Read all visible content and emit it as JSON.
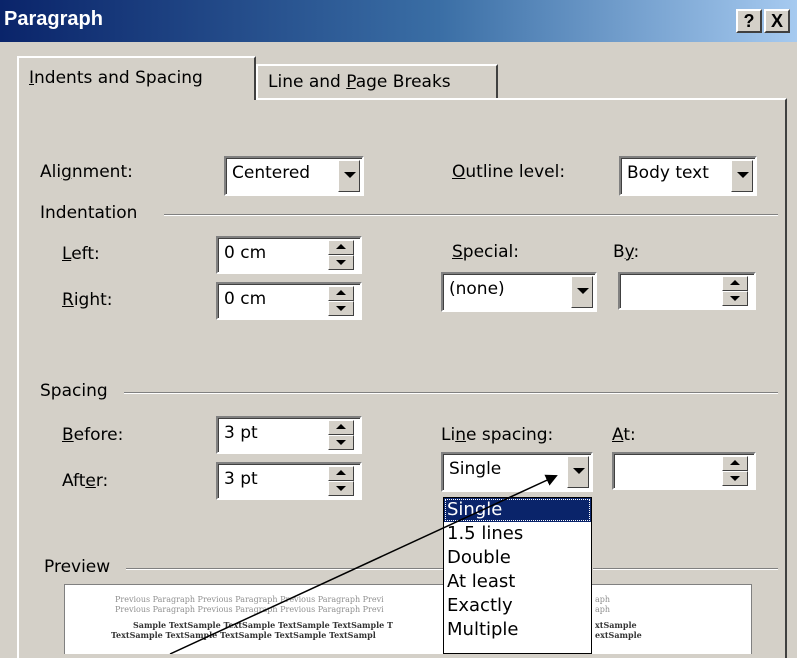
{
  "window": {
    "title": "Paragraph",
    "help_label": "?",
    "close_label": "X"
  },
  "tabs": [
    {
      "label_pre": "",
      "label_key": "I",
      "label_post": "ndents and Spacing",
      "active": true
    },
    {
      "label_pre": "Line and ",
      "label_key": "P",
      "label_post": "age Breaks",
      "active": false
    }
  ],
  "general": {
    "alignment": {
      "pre": "Ali",
      "key": "g",
      "post": "nment:",
      "value": "Centered"
    },
    "outline": {
      "pre": "",
      "key": "O",
      "post": "utline level:",
      "value": "Body text"
    }
  },
  "indentation": {
    "group_label": "Indentation",
    "left": {
      "pre": "",
      "key": "L",
      "post": "eft:",
      "value": "0 cm"
    },
    "right": {
      "pre": "",
      "key": "R",
      "post": "ight:",
      "value": "0 cm"
    },
    "special": {
      "pre": "",
      "key": "S",
      "post": "pecial:",
      "value": "(none)"
    },
    "by": {
      "pre": "B",
      "key": "y",
      "post": ":",
      "value": ""
    }
  },
  "spacing": {
    "group_label": "Spacing",
    "before": {
      "pre": "",
      "key": "B",
      "post": "efore:",
      "value": "3 pt"
    },
    "after": {
      "pre": "Aft",
      "key": "e",
      "post": "r:",
      "value": "3 pt"
    },
    "line_spacing": {
      "pre": "Li",
      "key": "n",
      "post": "e spacing:",
      "value": "Single"
    },
    "at": {
      "pre": "",
      "key": "A",
      "post": "t:",
      "value": ""
    }
  },
  "line_spacing_options": [
    "Single",
    "1.5 lines",
    "Double",
    "At least",
    "Exactly",
    "Multiple"
  ],
  "line_spacing_selected_index": 0,
  "preview": {
    "group_label": "Preview",
    "previous_line_1": "Previous Paragraph Previous Paragraph Previous Paragraph Previ",
    "previous_line_2": "Previous Paragraph Previous Paragraph Previous Paragraph Previ",
    "sample_line_1": "Sample TextSample TextSample TextSample TextSample T",
    "sample_line_2": "TextSample TextSample TextSample TextSample TextSampl",
    "right_fragment_1": "aph",
    "right_fragment_2": "aph",
    "right_fragment_3": "xtSample",
    "right_fragment_4": "extSample"
  }
}
